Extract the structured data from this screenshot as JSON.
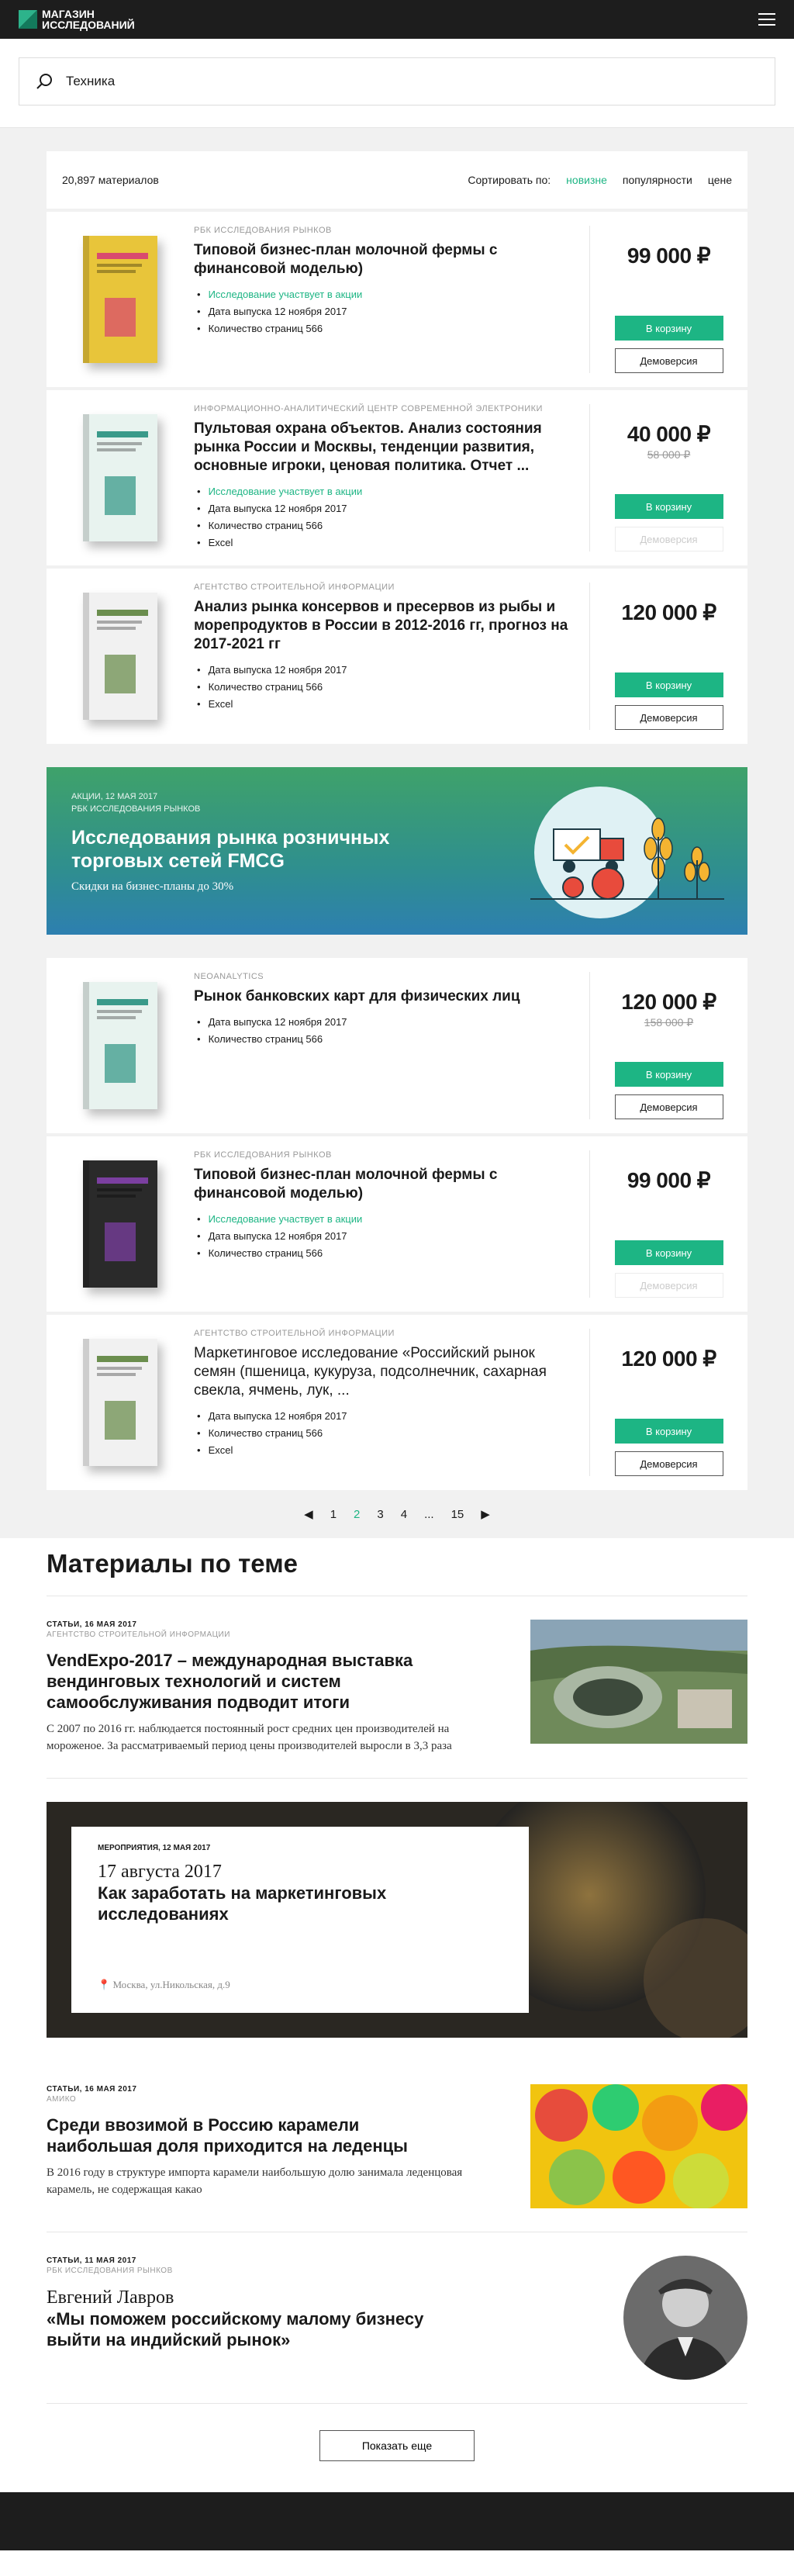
{
  "header": {
    "logo_line1": "МАГАЗИН",
    "logo_line2": "ИССЛЕДОВАНИЙ",
    "menu_icon": "burger-menu-icon"
  },
  "search": {
    "value": "Техника",
    "icon": "search-icon"
  },
  "catalog": {
    "count": "20,897 материалов",
    "sort_label": "Сортировать по:",
    "sorts": [
      "новизне",
      "популярности",
      "цене"
    ],
    "active_sort": "новизне",
    "items": [
      {
        "publisher": "РБК ИССЛЕДОВАНИЯ РЫНКОВ",
        "title": "Типовой бизнес-план молочной фермы с финансовой моделью)",
        "bullets": [
          "Исследование участвует в акции",
          "Дата выпуска 12 ноября 2017",
          "Количество страниц 566"
        ],
        "price": "99 000 ₽",
        "old_price": "",
        "cart": "В корзину",
        "demo": "Демоверсия",
        "demo_disabled": false
      },
      {
        "publisher": "ИНФОРМАЦИОННО-АНАЛИТИЧЕСКИЙ ЦЕНТР СОВРЕМЕННОЙ ЭЛЕКТРОНИКИ",
        "title": "Пультовая охрана объектов. Анализ состояния рынка России и Москвы, тенденции развития, основные игроки, ценовая политика. Отчет ...",
        "bullets": [
          "Исследование участвует в акции",
          "Дата выпуска 12 ноября 2017",
          "Количество страниц 566",
          "Excel"
        ],
        "price": "40 000 ₽",
        "old_price": "58 000 ₽",
        "cart": "В корзину",
        "demo": "Демоверсия",
        "demo_disabled": true
      },
      {
        "publisher": "АГЕНТСТВО СТРОИТЕЛЬНОЙ ИНФОРМАЦИИ",
        "title": "Анализ рынка консервов и пресервов из рыбы и морепродуктов в России в 2012-2016 гг, прогноз на 2017-2021 гг",
        "bullets": [
          "Дата выпуска 12 ноября 2017",
          "Количество страниц 566",
          "Excel"
        ],
        "price": "120 000 ₽",
        "old_price": "",
        "cart": "В корзину",
        "demo": "Демоверсия",
        "demo_disabled": false
      }
    ],
    "items2": [
      {
        "publisher": "NEOANALYTICS",
        "title": "Рынок банковских карт для физических лиц",
        "bullets": [
          "Дата выпуска 12 ноября 2017",
          "Количество страниц 566"
        ],
        "price": "120 000 ₽",
        "old_price": "158 000 ₽",
        "cart": "В корзину",
        "demo": "Демоверсия",
        "demo_disabled": false
      },
      {
        "publisher": "РБК ИССЛЕДОВАНИЯ РЫНКОВ",
        "title": "Типовой бизнес-план молочной фермы с финансовой моделью)",
        "bullets": [
          "Исследование участвует в акции",
          "Дата выпуска 12 ноября 2017",
          "Количество страниц 566"
        ],
        "price": "99 000 ₽",
        "old_price": "",
        "cart": "В корзину",
        "demo": "Демоверсия",
        "demo_disabled": true
      },
      {
        "publisher": "АГЕНТСТВО СТРОИТЕЛЬНОЙ ИНФОРМАЦИИ",
        "title": "Маркетинговое исследование «Российский рынок семян (пшеница, кукуруза, подсолнечник, сахарная свекла, ячмень, лук, ...",
        "bullets": [
          "Дата выпуска 12 ноября 2017",
          "Количество страниц 566",
          "Excel"
        ],
        "price": "120 000 ₽",
        "old_price": "",
        "cart": "В корзину",
        "demo": "Демоверсия",
        "demo_disabled": false
      }
    ],
    "banner": {
      "meta1": "АКЦИИ, 12 МАЯ 2017",
      "meta2": "РБК ИССЛЕДОВАНИЯ РЫНКОВ",
      "title": "Исследования рынка розничных торговых сетей FMCG",
      "subtitle": "Скидки на бизнес-планы до 30%"
    },
    "pager": {
      "prev": "◀",
      "pages": [
        "1",
        "2",
        "3",
        "4",
        "...",
        "15"
      ],
      "current": "2",
      "next": "▶"
    }
  },
  "materials": {
    "heading": "Материалы по теме",
    "a1": {
      "meta": "СТАТЬИ, 16 МАЯ 2017",
      "src": "АГЕНТСТВО СТРОИТЕЛЬНОЙ ИНФОРМАЦИИ",
      "title": "VendExpo-2017 – международная выставка вендинговых технологий и систем самообслуживания подводит итоги",
      "desc": "С 2007 по 2016 гг. наблюдается постоянный рост средних цен производителей на мороженое. За рассматриваемый период цены производителей выросли в 3,3 раза"
    },
    "event": {
      "meta": "МЕРОПРИЯТИЯ, 12 МАЯ 2017",
      "date": "17 августа 2017",
      "title": "Как заработать на маркетинговых исследованиях",
      "location": "Москва, ул.Никольская, д.9"
    },
    "a2": {
      "meta": "СТАТЬИ, 16 МАЯ 2017",
      "src": "АМИКО",
      "title": "Среди ввозимой в Россию карамели наибольшая доля приходится на леденцы",
      "desc": "В 2016 году в структуре импорта карамели наибольшую долю занимала леденцовая карамель, не содержащая какао"
    },
    "a3": {
      "meta": "СТАТЬИ, 11 МАЯ 2017",
      "src": "РБК ИССЛЕДОВАНИЯ РЫНКОВ",
      "who": "Евгений Лавров",
      "title": "«Мы поможем российскому малому бизнесу выйти на индийский рынок»"
    },
    "more": "Показать еще"
  },
  "colors": {
    "accent": "#1db584",
    "dark": "#1d1d1d"
  }
}
